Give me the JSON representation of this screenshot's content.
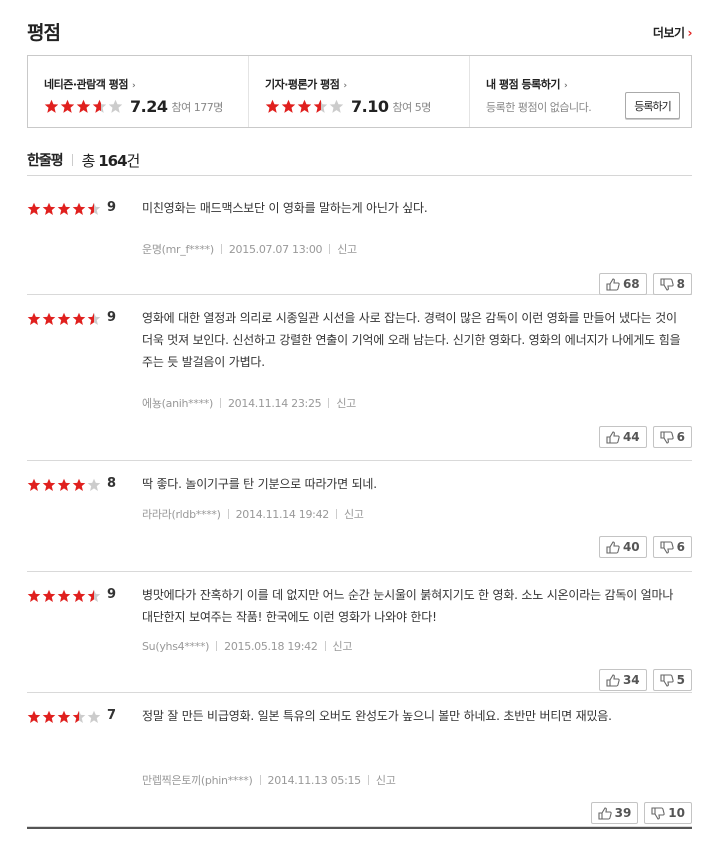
{
  "header": {
    "title": "평점",
    "more_label": "더보기",
    "more_chevron": "›"
  },
  "ratings": {
    "netizen": {
      "label": "네티즌·관람객 평점",
      "arrow": "›",
      "score": "7.24",
      "count": "참여 177명",
      "stars": 3.6
    },
    "critic": {
      "label": "기자·평론가 평점",
      "arrow": "›",
      "score": "7.10",
      "count": "참여 5명",
      "stars": 3.55
    },
    "mine": {
      "label": "내 평점 등록하기",
      "arrow": "›",
      "message": "등록한 평점이 없습니다.",
      "button": "등록하기"
    }
  },
  "reviews_section": {
    "title": "한줄평",
    "total_prefix": "총 ",
    "total_count": "164",
    "total_suffix": "건"
  },
  "reviews": [
    {
      "stars": 4.5,
      "score": "9",
      "text": "미친영화는 매드맥스보단 이 영화를 말하는게 아닌가 싶다.",
      "user": "운명(mr_f****)",
      "date": "2015.07.07 13:00",
      "report": "신고",
      "likes": "68",
      "dislikes": "8"
    },
    {
      "stars": 4.5,
      "score": "9",
      "text": "영화에 대한 열정과 의리로 시종일관 시선을 사로 잡는다. 경력이 많은 감독이 이런 영화를 만들어 냈다는 것이 더욱 멋져 보인다. 신선하고 강렬한 연출이 기억에 오래 남는다. 신기한 영화다. 영화의 에너지가 나에게도 힘을 주는 듯 발걸음이 가볍다.",
      "user": "에뇽(anih****)",
      "date": "2014.11.14 23:25",
      "report": "신고",
      "likes": "44",
      "dislikes": "6"
    },
    {
      "stars": 4,
      "score": "8",
      "text": "딱 좋다. 놀이기구를 탄 기분으로 따라가면 되네.",
      "user": "라라라(rldb****)",
      "date": "2014.11.14 19:42",
      "report": "신고",
      "likes": "40",
      "dislikes": "6"
    },
    {
      "stars": 4.5,
      "score": "9",
      "text": "병맛에다가 잔혹하기 이를 데 없지만 어느 순간 눈시울이 붉혀지기도 한 영화. 소노 시온이라는 감독이 얼마나 대단한지 보여주는 작품! 한국에도 이런 영화가 나와야 한다!",
      "user": "Su(yhs4****)",
      "date": "2015.05.18 19:42",
      "report": "신고",
      "likes": "34",
      "dislikes": "5"
    },
    {
      "stars": 3.5,
      "score": "7",
      "text": "정말 잘 만든 비급영화. 일본 특유의 오버도 완성도가 높으니 볼만 하네요. 초반만 버티면 재밌음.",
      "user": "만렙찍은토끼(phin****)",
      "date": "2014.11.13 05:15",
      "report": "신고",
      "likes": "39",
      "dislikes": "10"
    }
  ],
  "colors": {
    "star_on": "#e0201e",
    "star_off": "#cccccc",
    "accent": "#e0201e"
  },
  "icons": {
    "star": "star-icon",
    "like": "thumbs-up-icon",
    "dislike": "thumbs-down-icon"
  }
}
